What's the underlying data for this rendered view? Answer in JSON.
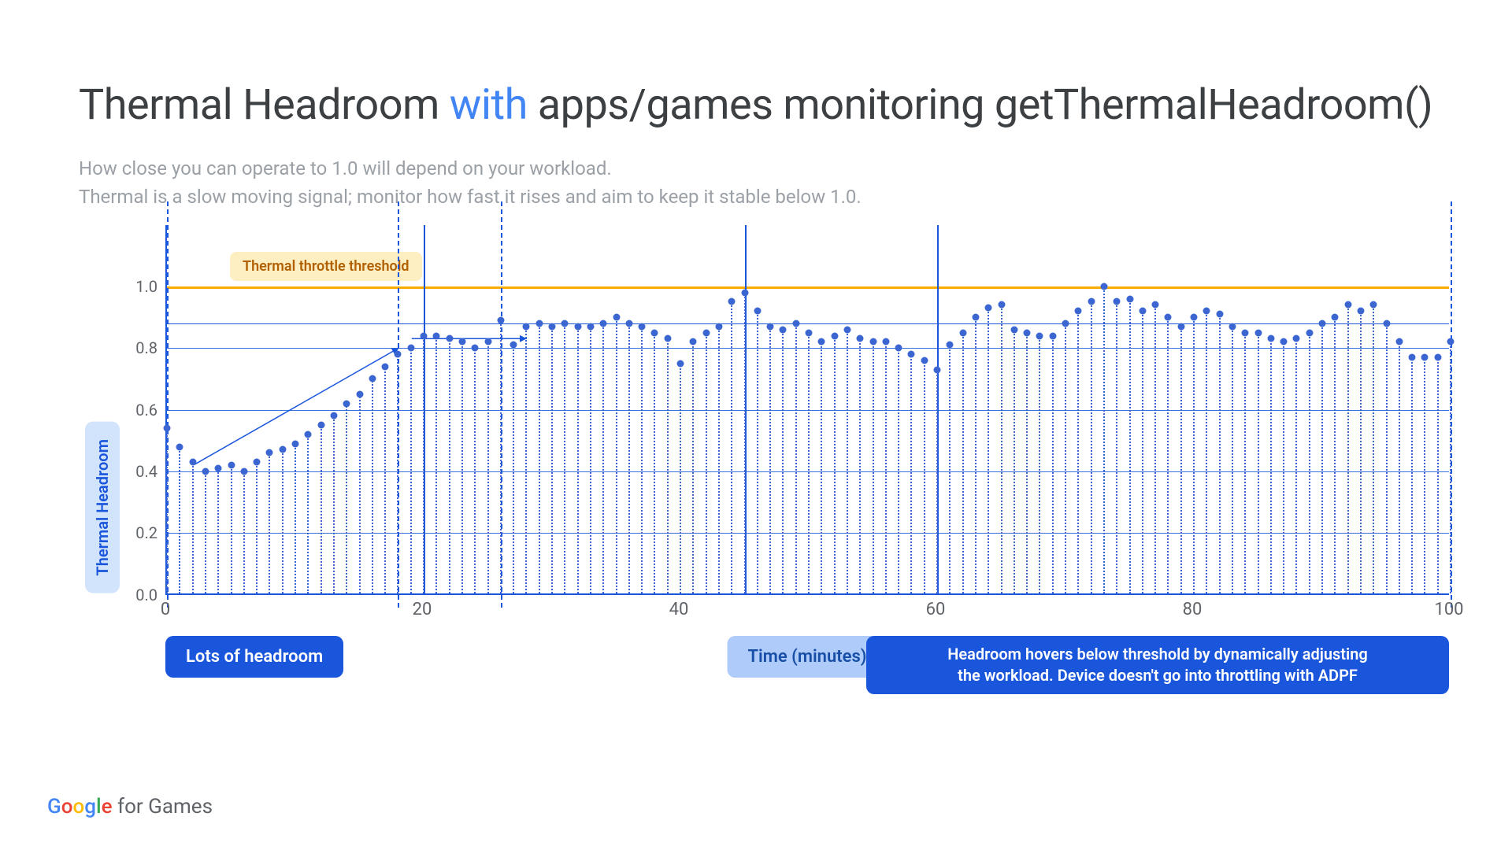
{
  "title": {
    "pre": "Thermal Headroom ",
    "accent": "with",
    "post": " apps/games monitoring getThermalHeadroom()"
  },
  "subtitle_line1": "How close you can operate to 1.0 will depend on your workload.",
  "subtitle_line2": "Thermal is a slow moving signal; monitor how fast it rises and aim to keep it stable below 1.0.",
  "ylabel": "Thermal Headroom",
  "xlabel": "Time (minutes)",
  "threshold_label": "Thermal throttle threshold",
  "annotation_left": "Lots of headroom",
  "annotation_right_line1": "Headroom hovers below threshold by dynamically adjusting",
  "annotation_right_line2": "the workload. Device doesn't go into throttling with ADPF",
  "footer": {
    "google": "Google",
    "suffix": " for Games"
  },
  "chart_data": {
    "type": "scatter",
    "title": "Thermal Headroom with apps/games monitoring getThermalHeadroom()",
    "xlabel": "Time (minutes)",
    "ylabel": "Thermal Headroom",
    "xlim": [
      0,
      100
    ],
    "ylim": [
      0.0,
      1.2
    ],
    "xticks": [
      0,
      20,
      40,
      60,
      80,
      100
    ],
    "yticks": [
      0.0,
      0.2,
      0.4,
      0.6,
      0.8,
      1.0
    ],
    "threshold": 1.0,
    "region_dividers_dashed": [
      0,
      18,
      26,
      100
    ],
    "region_dividers_solid": [
      20,
      45,
      60
    ],
    "guide_hline": 0.88,
    "series": [
      {
        "name": "Thermal Headroom",
        "x": [
          0,
          1,
          2,
          3,
          4,
          5,
          6,
          7,
          8,
          9,
          10,
          11,
          12,
          13,
          14,
          15,
          16,
          17,
          18,
          19,
          20,
          21,
          22,
          23,
          24,
          25,
          26,
          27,
          28,
          29,
          30,
          31,
          32,
          33,
          34,
          35,
          36,
          37,
          38,
          39,
          40,
          41,
          42,
          43,
          44,
          45,
          46,
          47,
          48,
          49,
          50,
          51,
          52,
          53,
          54,
          55,
          56,
          57,
          58,
          59,
          60,
          61,
          62,
          63,
          64,
          65,
          66,
          67,
          68,
          69,
          70,
          71,
          72,
          73,
          74,
          75,
          76,
          77,
          78,
          79,
          80,
          81,
          82,
          83,
          84,
          85,
          86,
          87,
          88,
          89,
          90,
          91,
          92,
          93,
          94,
          95,
          96,
          97,
          98,
          99,
          100
        ],
        "y": [
          0.54,
          0.48,
          0.43,
          0.4,
          0.41,
          0.42,
          0.4,
          0.43,
          0.46,
          0.47,
          0.49,
          0.52,
          0.55,
          0.58,
          0.62,
          0.65,
          0.7,
          0.74,
          0.78,
          0.8,
          0.84,
          0.84,
          0.83,
          0.82,
          0.8,
          0.82,
          0.89,
          0.81,
          0.87,
          0.88,
          0.87,
          0.88,
          0.87,
          0.87,
          0.88,
          0.9,
          0.88,
          0.87,
          0.85,
          0.83,
          0.75,
          0.82,
          0.85,
          0.87,
          0.95,
          0.98,
          0.92,
          0.87,
          0.86,
          0.88,
          0.85,
          0.82,
          0.84,
          0.86,
          0.83,
          0.82,
          0.82,
          0.8,
          0.78,
          0.76,
          0.73,
          0.81,
          0.85,
          0.9,
          0.93,
          0.94,
          0.86,
          0.85,
          0.84,
          0.84,
          0.88,
          0.92,
          0.95,
          1.0,
          0.95,
          0.96,
          0.92,
          0.94,
          0.9,
          0.87,
          0.9,
          0.92,
          0.91,
          0.87,
          0.85,
          0.85,
          0.83,
          0.82,
          0.83,
          0.85,
          0.88,
          0.9,
          0.94,
          0.92,
          0.94,
          0.88,
          0.82,
          0.77,
          0.77,
          0.77,
          0.82
        ]
      }
    ],
    "annotations": [
      {
        "text": "Thermal throttle threshold",
        "y": 1.0
      },
      {
        "text": "Lots of headroom",
        "x_range": [
          0,
          18
        ]
      },
      {
        "text": "Headroom hovers below threshold by dynamically adjusting the workload. Device doesn't go into throttling with ADPF",
        "x_range": [
          26,
          100
        ]
      }
    ]
  }
}
